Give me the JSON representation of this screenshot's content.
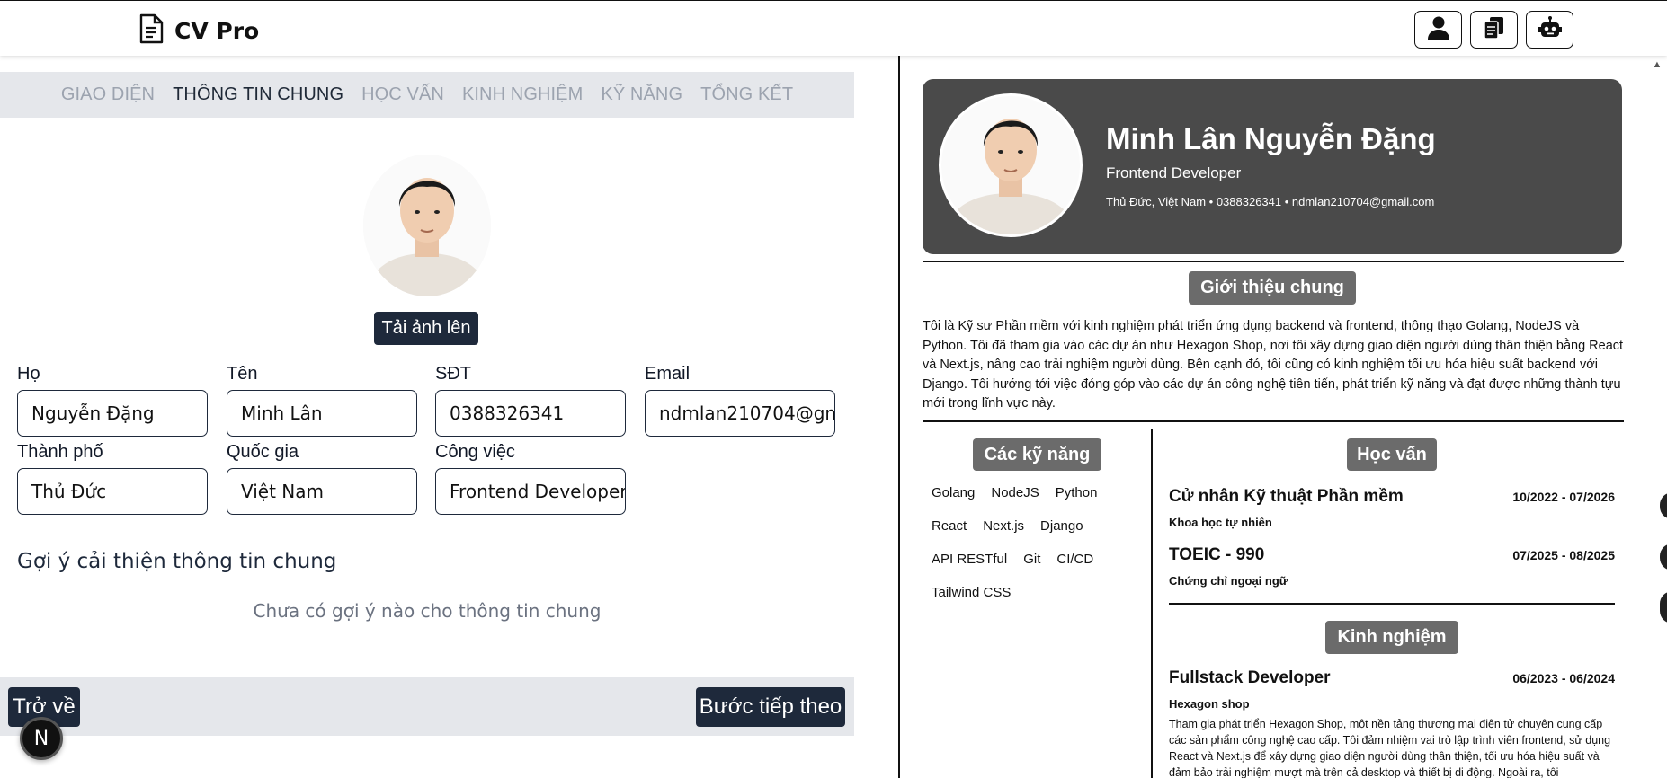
{
  "app": {
    "title": "CV Pro"
  },
  "top_actions": [
    "user-icon",
    "copy-icon",
    "robot-icon"
  ],
  "tabs": [
    "GIAO DIỆN",
    "THÔNG TIN CHUNG",
    "HỌC VẤN",
    "KINH NGHIỆM",
    "KỸ NĂNG",
    "TỔNG KẾT"
  ],
  "active_tab": "THÔNG TIN CHUNG",
  "upload_label": "Tải ảnh lên",
  "fields": {
    "last_name": {
      "label": "Họ",
      "value": "Nguyễn Đặng"
    },
    "first_name": {
      "label": "Tên",
      "value": "Minh Lân"
    },
    "phone": {
      "label": "SĐT",
      "value": "0388326341"
    },
    "email": {
      "label": "Email",
      "value": "ndmlan210704@gmail.com"
    },
    "city": {
      "label": "Thành phố",
      "value": "Thủ Đức"
    },
    "country": {
      "label": "Quốc gia",
      "value": "Việt Nam"
    },
    "job": {
      "label": "Công việc",
      "value": "Frontend Developer"
    }
  },
  "suggestions": {
    "title": "Gợi ý cải thiện thông tin chung",
    "empty": "Chưa có gợi ý nào cho thông tin chung"
  },
  "nav": {
    "back": "Trở về",
    "next": "Bước tiếp theo",
    "badge": "N"
  },
  "cv": {
    "name": "Minh Lân Nguyễn Đặng",
    "job": "Frontend Developer",
    "contact": "Thủ Đức, Việt Nam • 0388326341 • ndmlan210704@gmail.com",
    "intro_title": "Giới thiệu chung",
    "intro": "Tôi là Kỹ sư Phần mềm với kinh nghiệm phát triển ứng dụng backend và frontend, thông thạo Golang, NodeJS và Python. Tôi đã tham gia vào các dự án như Hexagon Shop, nơi tôi xây dựng giao diện người dùng thân thiện bằng React và Next.js, nâng cao trải nghiệm người dùng. Bên cạnh đó, tôi cũng có kinh nghiệm tối ưu hóa hiệu suất backend với Django. Tôi hướng tới việc đóng góp vào các dự án công nghệ tiên tiến, phát triển kỹ năng và đạt được những thành tựu mới trong lĩnh vực này.",
    "skills_title": "Các kỹ năng",
    "skills": [
      "Golang",
      "NodeJS",
      "Python",
      "React",
      "Next.js",
      "Django",
      "API RESTful",
      "Git",
      "CI/CD",
      "Tailwind CSS"
    ],
    "education_title": "Học vấn",
    "education": [
      {
        "title": "Cử nhân Kỹ thuật Phần mềm",
        "date": "10/2022 - 07/2026",
        "sub": "Khoa học tự nhiên"
      },
      {
        "title": "TOEIC - 990",
        "date": "07/2025 - 08/2025",
        "sub": "Chứng chỉ ngoại ngữ"
      }
    ],
    "experience_title": "Kinh nghiệm",
    "experience": [
      {
        "title": "Fullstack Developer",
        "date": "06/2023 - 06/2024",
        "sub": "Hexagon shop",
        "desc": "Tham gia phát triển Hexagon Shop, một nền tảng thương mại điện tử chuyên cung cấp các sản phẩm công nghệ cao cấp. Tôi đảm nhiệm vai trò lập trình viên frontend, sử dụng React và Next.js để xây dựng giao diện người dùng thân thiện, tối ưu hóa hiệu suất và đảm bảo trải nghiệm mượt mà trên cả desktop và thiết bị di động. Ngoài ra, tôi"
      }
    ]
  }
}
